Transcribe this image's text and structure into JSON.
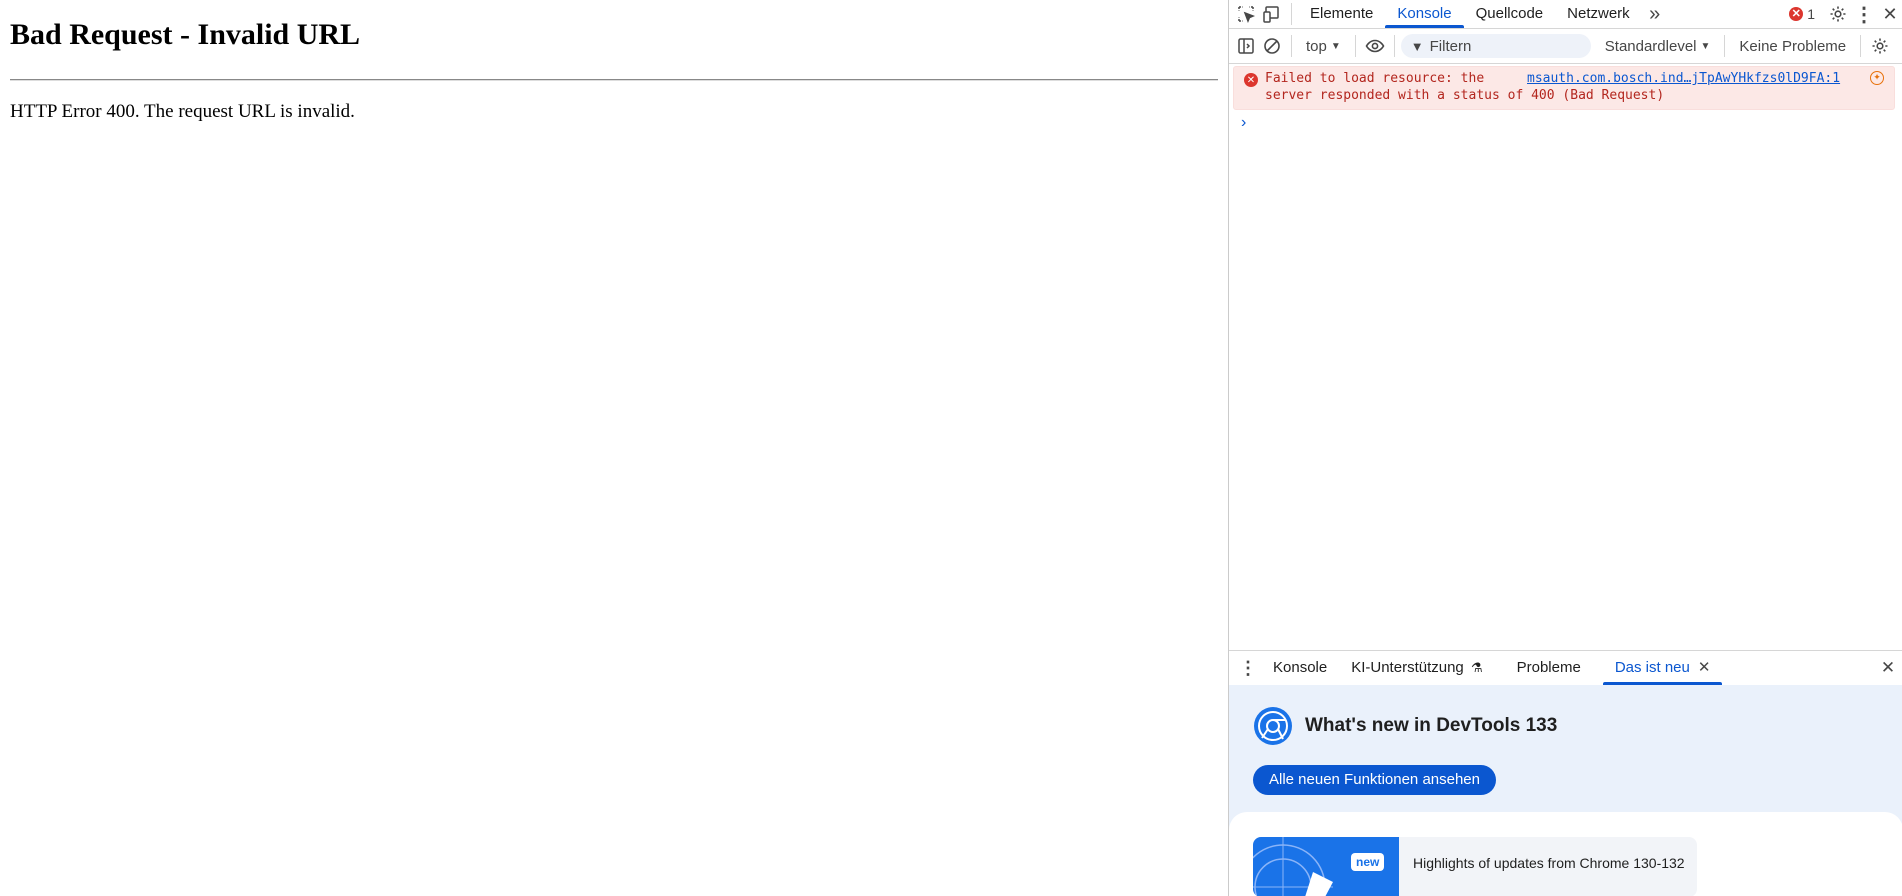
{
  "page": {
    "heading": "Bad Request - Invalid URL",
    "message": "HTTP Error 400. The request URL is invalid."
  },
  "devtools": {
    "tabs": [
      {
        "label": "Elemente"
      },
      {
        "label": "Konsole",
        "active": true
      },
      {
        "label": "Quellcode"
      },
      {
        "label": "Netzwerk"
      }
    ],
    "more_tabs": "»",
    "error_count": "1",
    "toolbar": {
      "context": "top",
      "filter_placeholder": "Filtern",
      "level": "Standardlevel",
      "issues": "Keine Probleme"
    },
    "console": {
      "message_line1": "Failed to load resource: the",
      "message_line2": "server responded with a status of 400 (Bad Request)",
      "source_link": "msauth.com.bosch.ind…jTpAwYHkfzs0lD9FA:1",
      "prompt": "›"
    },
    "drawer": {
      "tabs": [
        {
          "label": "Konsole"
        },
        {
          "label": "KI-Unterstützung"
        },
        {
          "label": "Probleme"
        },
        {
          "label": "Das ist neu",
          "active": true
        }
      ],
      "whats_new_title": "What's new in DevTools 133",
      "whats_new_button": "Alle neuen Funktionen ansehen",
      "card_badge": "new",
      "card_text": "Highlights of updates from Chrome 130-132"
    }
  },
  "colors": {
    "accent": "#0b57d0",
    "error_bg": "#fce8e6",
    "error_text": "#b3261e",
    "drawer_bg": "#eaf1fb"
  }
}
